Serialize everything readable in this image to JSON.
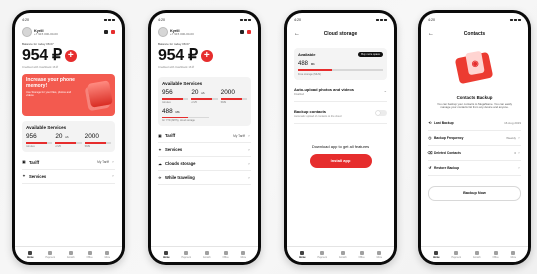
{
  "screens": [
    {
      "time": "4:20",
      "user": {
        "name": "Kyrill",
        "phone": "+7 915 000-00-00"
      },
      "balance": {
        "label": "Balance for today 08.07",
        "value": "954 ₽",
        "credit": "Credited with Cashback 16 ₽"
      },
      "promo": {
        "title": "Increase your phone memory!",
        "text": "Use Storage for your files, photos and videos"
      },
      "services": {
        "title": "Available Services",
        "items": [
          {
            "value": "956",
            "unit": "",
            "sub": "minutes",
            "fill": 0.78
          },
          {
            "value": "20",
            "unit": "sh",
            "sub": "of 25",
            "fill": 0.8
          },
          {
            "value": "2000",
            "unit": "",
            "sub": "SMS",
            "fill": 0.82
          }
        ]
      },
      "menu": [
        {
          "label": "Tariff",
          "right": "My Tariff",
          "icon": "tariff-icon"
        },
        {
          "label": "Services",
          "right": "",
          "icon": "services-icon"
        }
      ],
      "nav": [
        "Home",
        "Payment",
        "Growth",
        "Office",
        "More"
      ]
    },
    {
      "time": "4:20",
      "user": {
        "name": "Kyrill",
        "phone": "+7 915 000-00-00"
      },
      "balance": {
        "label": "Balance for today 08.07",
        "value": "954 ₽",
        "credit": "Credited with Cashback 16 ₽"
      },
      "services": {
        "title": "Available Services",
        "items": [
          {
            "value": "956",
            "unit": "",
            "sub": "minutes",
            "fill": 0.78
          },
          {
            "value": "20",
            "unit": "sh",
            "sub": "of 25",
            "fill": 0.8
          },
          {
            "value": "2000",
            "unit": "",
            "sub": "SMS",
            "fill": 0.82
          }
        ],
        "extra": {
          "value": "488",
          "unit": "Mb",
          "sub": "for YTD (MHS), cloud storage",
          "fill": 0.55
        }
      },
      "menu": [
        {
          "label": "Tariff",
          "right": "My Tariff",
          "icon": "tariff-icon"
        },
        {
          "label": "Services",
          "right": "",
          "icon": "services-icon"
        },
        {
          "label": "Clouds storage",
          "right": "",
          "icon": "cloud-icon"
        },
        {
          "label": "While traveling",
          "right": "",
          "icon": "travel-icon"
        }
      ],
      "nav": [
        "Home",
        "Payment",
        "Growth",
        "Office",
        "More"
      ]
    },
    {
      "time": "4:20",
      "title": "Cloud storage",
      "available": {
        "label": "Available",
        "pill": "Buy more space",
        "value": "488",
        "unit": "Mb",
        "sub": "Free storage (MHS)",
        "fill": 0.4
      },
      "settings": [
        {
          "title": "Auto-upload photos and videos",
          "sub": "Disabled",
          "control": "arrow"
        },
        {
          "title": "Backup contacts",
          "sub": "Automatic upload of contacts to the cloud",
          "control": "toggle"
        }
      ],
      "download_note": "Download app to get all features",
      "install_label": "Install app",
      "nav": [
        "Home",
        "Payment",
        "Growth",
        "Office",
        "More"
      ]
    },
    {
      "time": "4:20",
      "title": "Contacts",
      "backup": {
        "title": "Contacts Backup",
        "desc": "You can backup your contacts to MegaName. You can easily manage your contacts list from any device and anyone.",
        "rows": [
          {
            "label": "Last Backup",
            "value": "16 Aug 2019",
            "icon": "history-icon"
          },
          {
            "label": "Backup Frequency",
            "value": "Weekly",
            "icon": "frequency-icon"
          },
          {
            "label": "Deleted Contacts",
            "value": "0",
            "icon": "deleted-icon"
          },
          {
            "label": "Restore Backup",
            "value": "",
            "icon": "restore-icon"
          }
        ],
        "button": "Backup Now"
      },
      "nav": [
        "Home",
        "Payment",
        "Growth",
        "Office",
        "More"
      ]
    }
  ]
}
